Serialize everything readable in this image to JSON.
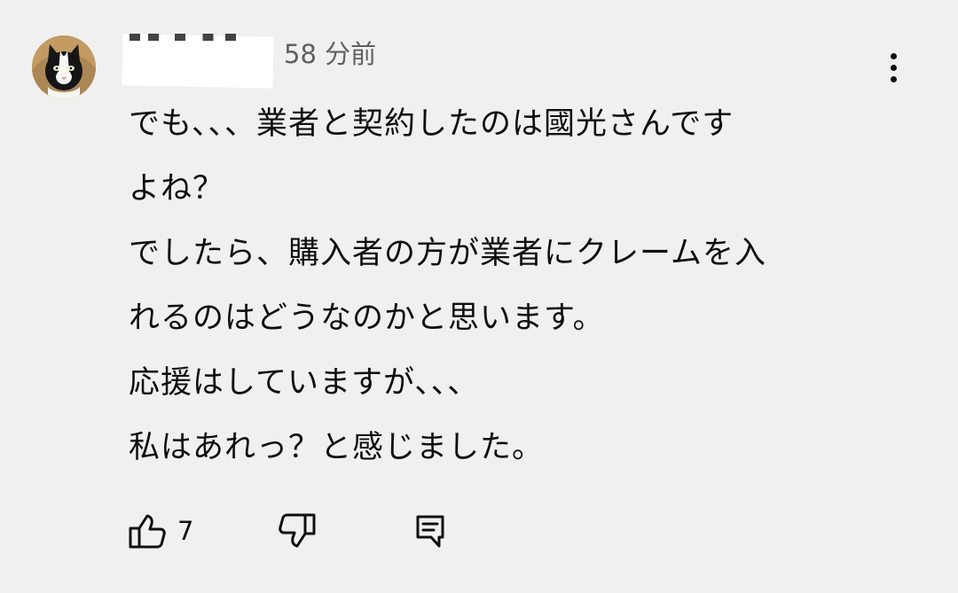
{
  "comment": {
    "timestamp": "58 分前",
    "text_lines": [
      "でも、、、業者と契約したのは國光さんです",
      "よね？",
      "でしたら、購入者の方が業者にクレームを入",
      "れるのはどうなのかと思います。",
      "応援はしていますが、、、",
      "私はあれっ？と感じました。"
    ],
    "like_count": "7",
    "icons": {
      "avatar": "cat-avatar",
      "more": "more-vertical-icon",
      "like": "thumbs-up-icon",
      "dislike": "thumbs-down-icon",
      "reply": "reply-icon"
    }
  }
}
